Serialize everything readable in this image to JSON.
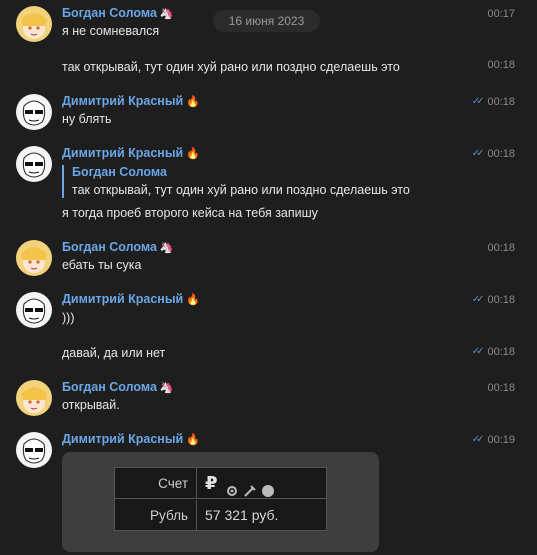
{
  "date_label": "16 июня 2023",
  "messages": [
    {
      "author": "Богдан Солома",
      "emoji": "🦄",
      "text": "я не сомневался",
      "time": "00:17",
      "read": false
    },
    {
      "author": "",
      "emoji": "",
      "text": "так открывай, тут один хуй рано или поздно сделаешь это",
      "time": "00:18",
      "read": false
    },
    {
      "author": "Димитрий Красный",
      "emoji": "🔥",
      "text": "ну блять",
      "time": "00:18",
      "read": true
    },
    {
      "author": "Димитрий Красный",
      "emoji": "🔥",
      "quote_author": "Богдан Солома",
      "quote_text": "так открывай, тут один хуй рано или поздно сделаешь это",
      "text": "я тогда проеб второго кейса на тебя запишу",
      "time": "00:18",
      "read": true
    },
    {
      "author": "Богдан Солома",
      "emoji": "🦄",
      "text": "ебать ты сука",
      "time": "00:18",
      "read": false
    },
    {
      "author": "Димитрий Красный",
      "emoji": "🔥",
      "text": ")))",
      "time": "00:18",
      "read": true
    },
    {
      "author": "",
      "emoji": "",
      "text": "давай, да или нет",
      "time": "00:18",
      "read": true
    },
    {
      "author": "Богдан Солома",
      "emoji": "🦄",
      "text": "открывай.",
      "time": "00:18",
      "read": false
    },
    {
      "author": "Димитрий Красный",
      "emoji": "🔥",
      "text": "",
      "time": "00:19",
      "read": true
    }
  ],
  "image_attachment": {
    "row1_label": "Счет",
    "row1_value": "₽",
    "row2_label": "Рубль",
    "row2_value": "57 321 руб."
  },
  "icons": [
    "avatar-bogdan",
    "avatar-dimitriy",
    "double-check-icon",
    "ruble-icon",
    "gear-icon",
    "tool-icon",
    "compass-icon"
  ],
  "colors": {
    "background": "#1e1e1e",
    "name": "#6aa6e8",
    "checks": "#5b8fd1",
    "time": "#8a8a8a"
  }
}
